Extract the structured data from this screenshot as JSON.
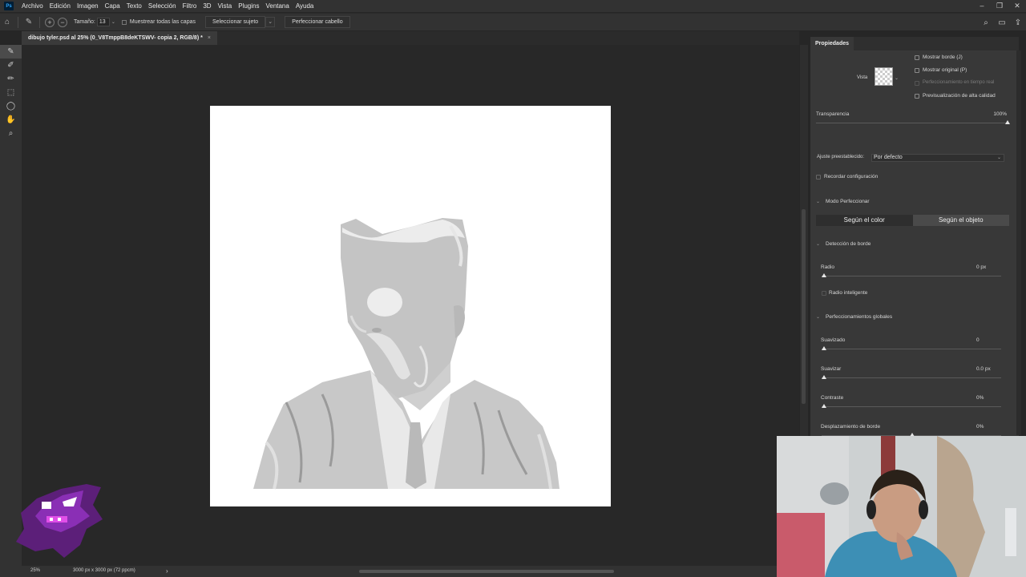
{
  "app": {
    "logo": "Ps",
    "menu": [
      "Archivo",
      "Edición",
      "Imagen",
      "Capa",
      "Texto",
      "Selección",
      "Filtro",
      "3D",
      "Vista",
      "Plugins",
      "Ventana",
      "Ayuda"
    ],
    "window_controls": [
      "minimize-icon",
      "restore-icon",
      "close-icon"
    ]
  },
  "options_bar": {
    "size_label": "Tamaño:",
    "size_value": "13",
    "sample_all_label": "Muestrear todas las capas",
    "select_subject_label": "Seleccionar sujeto",
    "refine_hair_label": "Perfeccionar cabello"
  },
  "document": {
    "tab_title": "dibujo tyler.psd al 25% (0_V8TmppB8deKTSWV- copia 2, RGB/8) *",
    "close": "×"
  },
  "toolbar": {
    "tools": [
      "quick-selection-icon",
      "refine-edge-brush-icon",
      "brush-icon",
      "object-selection-icon",
      "lasso-icon",
      "hand-icon",
      "zoom-icon"
    ],
    "active_index": 0
  },
  "status": {
    "zoom": "25%",
    "doc_info": "3000 px x 3000 px (72 ppcm)",
    "arrow": "›"
  },
  "properties": {
    "tab": "Propiedades",
    "vista_label": "Vista",
    "show_edge": "Mostrar borde (J)",
    "show_original": "Mostrar original (P)",
    "realtime_refine": "Perfeccionamiento en tiempo real",
    "hq_preview": "Previsualización de alta calidad",
    "transparency_label": "Transparencia",
    "transparency_value": "100%",
    "transparency_level": 1.0,
    "preset_label": "Ajuste preestablecido:",
    "preset_value": "Por defecto",
    "remember_settings": "Recordar configuración",
    "refine_mode_header": "Modo Perfeccionar",
    "mode_color": "Según el color",
    "mode_object": "Según el objeto",
    "active_mode": "object",
    "edge_detection_header": "Detección de borde",
    "radius_label": "Radio",
    "radius_value": "0 px",
    "smart_radius": "Radio inteligente",
    "global_header": "Perfeccionamientos globales",
    "smooth_label": "Suavizado",
    "smooth_value": "0",
    "feather_label": "Suavizar",
    "feather_value": "0.0 px",
    "contrast_label": "Contraste",
    "contrast_value": "0%",
    "shift_edge_label": "Desplazamiento de borde",
    "shift_edge_value": "0%"
  }
}
